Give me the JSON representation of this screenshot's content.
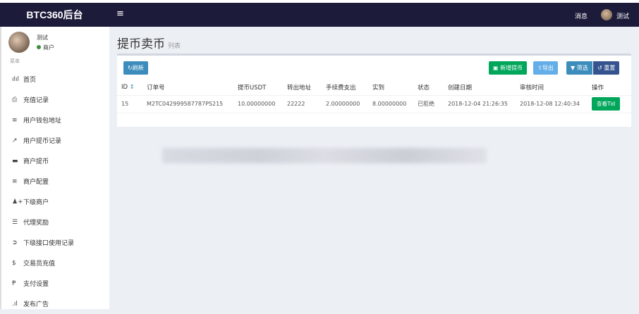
{
  "header": {
    "logo": "BTC360后台",
    "toggle": "≡",
    "messages": "消息",
    "user": "测试"
  },
  "sidebar": {
    "user_name": "测试",
    "user_role": "商户",
    "menu_heading": "菜单",
    "items": [
      {
        "icon": "bar-chart-icon",
        "glyph": "ılıl",
        "label": "首页"
      },
      {
        "icon": "clipboard-icon",
        "glyph": "⎙",
        "label": "充值记录"
      },
      {
        "icon": "list-icon",
        "glyph": "≡",
        "label": "用户钱包地址"
      },
      {
        "icon": "external-link-icon",
        "glyph": "↗",
        "label": "用户提币记录"
      },
      {
        "icon": "credit-card-icon",
        "glyph": "▬",
        "label": "商户提币"
      },
      {
        "icon": "list-icon",
        "glyph": "≡",
        "label": "商户配置"
      },
      {
        "icon": "user-plus-icon",
        "glyph": "♟+",
        "label": "下级商户"
      },
      {
        "icon": "server-icon",
        "glyph": "☰",
        "label": "代理奖励"
      },
      {
        "icon": "arrow-circle-icon",
        "glyph": "➲",
        "label": "下级接口使用记录"
      },
      {
        "icon": "dollar-icon",
        "glyph": "$",
        "label": "交易员充值"
      },
      {
        "icon": "paypal-icon",
        "glyph": "Ᵽ",
        "label": "支付设置"
      },
      {
        "icon": "signal-icon",
        "glyph": ".ıl",
        "label": "发布广告"
      }
    ]
  },
  "page": {
    "title": "提币卖币",
    "subtitle": "列表"
  },
  "toolbar": {
    "refresh": "↻刷新",
    "add": "▣ 新增提币",
    "export": "⇪导出",
    "filter": "▼ 筛选",
    "reset": "↺ 重置"
  },
  "table": {
    "headers": [
      "ID",
      "订单号",
      "提币USDT",
      "转出地址",
      "手续费支出",
      "实到",
      "状态",
      "创建日期",
      "审核时间",
      "操作"
    ],
    "rows": [
      {
        "id": "15",
        "order": "M2TC042999587787PS215",
        "usdt": "10.00000000",
        "address": "22222",
        "fee": "2.00000000",
        "actual": "8.00000000",
        "status": "已拒绝",
        "created": "2018-12-04 21:26:35",
        "reviewed": "2018-12-08 12:40:34",
        "action": "查看Tid"
      }
    ]
  }
}
